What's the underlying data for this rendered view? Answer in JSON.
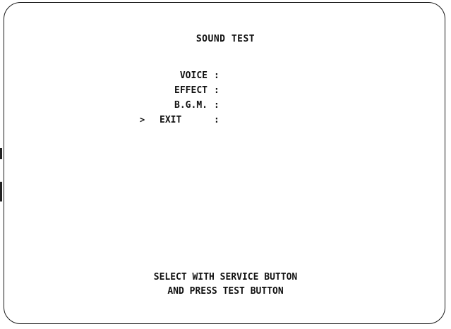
{
  "screen": {
    "title": "SOUND TEST",
    "cursor": ">",
    "menu": [
      {
        "label": "VOICE",
        "separator": ":",
        "selected": false
      },
      {
        "label": "EFFECT",
        "separator": ":",
        "selected": false
      },
      {
        "label": "B.G.M.",
        "separator": ":",
        "selected": false
      },
      {
        "label": "EXIT",
        "separator": ":",
        "selected": true
      }
    ],
    "instructions": {
      "line1": "SELECT WITH SERVICE BUTTON",
      "line2": "AND PRESS TEST BUTTON"
    }
  }
}
